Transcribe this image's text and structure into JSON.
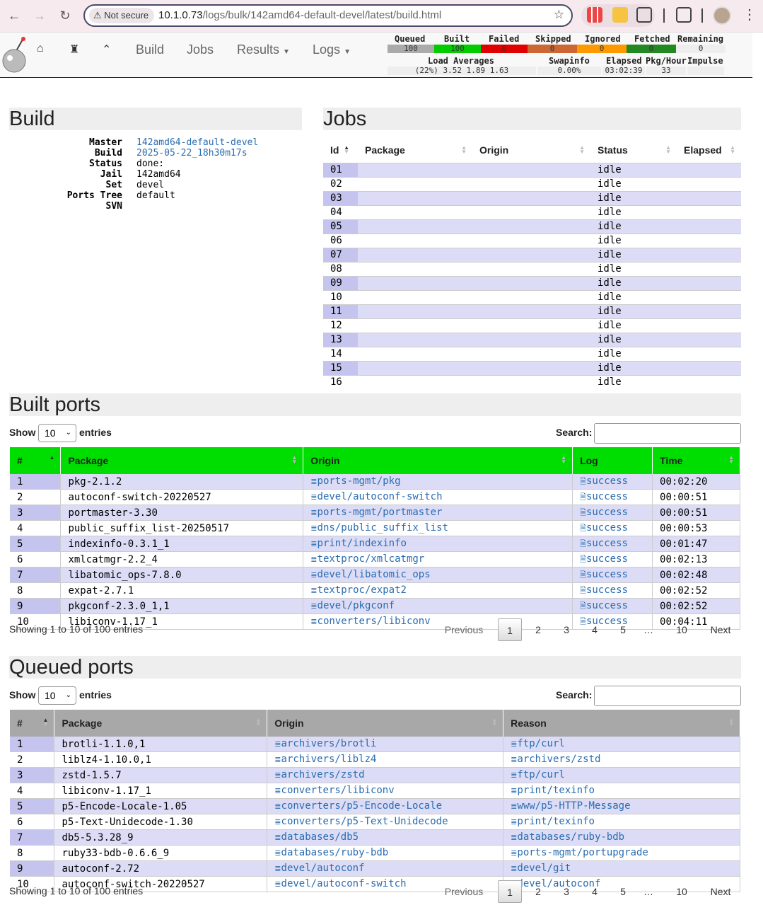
{
  "browser": {
    "security_label": "Not secure",
    "url_host": "10.1.0.73",
    "url_path": "/logs/bulk/142amd64-default-devel/latest/build.html"
  },
  "nav": {
    "links": [
      "Build",
      "Jobs",
      "Results",
      "Logs"
    ]
  },
  "stats": {
    "headers": [
      "Queued",
      "Built",
      "Failed",
      "Skipped",
      "Ignored",
      "Fetched",
      "Remaining"
    ],
    "values": [
      "100",
      "100",
      "0",
      "0",
      "0",
      "0",
      "0"
    ],
    "colors": [
      "#aaaaaa",
      "#00cc00",
      "#e00000",
      "#cc6633",
      "#ff9900",
      "#228822",
      "#eeeeee"
    ],
    "load_label": "Load Averages",
    "load_value": "(22%) 3.52 1.89 1.63",
    "swap_label": "Swapinfo",
    "swap_value": "0.00%",
    "elapsed_label": "Elapsed",
    "elapsed_value": "03:02:39",
    "pkghour_label": "Pkg/Hour",
    "pkghour_value": "33",
    "impulse_label": "Impulse",
    "impulse_value": ""
  },
  "build": {
    "title": "Build",
    "fields": [
      {
        "k": "Master",
        "v": "142amd64-default-devel",
        "link": true
      },
      {
        "k": "Build",
        "v": "2025-05-22_18h30m17s",
        "link": true
      },
      {
        "k": "Status",
        "v": "done:",
        "link": false
      },
      {
        "k": "Jail",
        "v": "142amd64",
        "link": false
      },
      {
        "k": "Set",
        "v": "devel",
        "link": false
      },
      {
        "k": "Ports Tree",
        "v": "default",
        "link": false
      },
      {
        "k": "SVN",
        "v": "",
        "link": false
      }
    ]
  },
  "jobs": {
    "title": "Jobs",
    "headers": [
      "Id",
      "Package",
      "Origin",
      "Status",
      "Elapsed"
    ],
    "rows": [
      [
        "01",
        "idle"
      ],
      [
        "02",
        "idle"
      ],
      [
        "03",
        "idle"
      ],
      [
        "04",
        "idle"
      ],
      [
        "05",
        "idle"
      ],
      [
        "06",
        "idle"
      ],
      [
        "07",
        "idle"
      ],
      [
        "08",
        "idle"
      ],
      [
        "09",
        "idle"
      ],
      [
        "10",
        "idle"
      ],
      [
        "11",
        "idle"
      ],
      [
        "12",
        "idle"
      ],
      [
        "13",
        "idle"
      ],
      [
        "14",
        "idle"
      ],
      [
        "15",
        "idle"
      ],
      [
        "16",
        "idle"
      ]
    ]
  },
  "built": {
    "title": "Built ports",
    "show": "Show",
    "entries": "entries",
    "page_size": "10",
    "search": "Search:",
    "headers": [
      "#",
      "Package",
      "Origin",
      "Log",
      "Time"
    ],
    "rows": [
      [
        "1",
        "pkg-2.1.2",
        "ports-mgmt/pkg",
        "success",
        "00:02:20"
      ],
      [
        "2",
        "autoconf-switch-20220527",
        "devel/autoconf-switch",
        "success",
        "00:00:51"
      ],
      [
        "3",
        "portmaster-3.30",
        "ports-mgmt/portmaster",
        "success",
        "00:00:51"
      ],
      [
        "4",
        "public_suffix_list-20250517",
        "dns/public_suffix_list",
        "success",
        "00:00:53"
      ],
      [
        "5",
        "indexinfo-0.3.1_1",
        "print/indexinfo",
        "success",
        "00:01:47"
      ],
      [
        "6",
        "xmlcatmgr-2.2_4",
        "textproc/xmlcatmgr",
        "success",
        "00:02:13"
      ],
      [
        "7",
        "libatomic_ops-7.8.0",
        "devel/libatomic_ops",
        "success",
        "00:02:48"
      ],
      [
        "8",
        "expat-2.7.1",
        "textproc/expat2",
        "success",
        "00:02:52"
      ],
      [
        "9",
        "pkgconf-2.3.0_1,1",
        "devel/pkgconf",
        "success",
        "00:02:52"
      ],
      [
        "10",
        "libiconv-1.17_1",
        "converters/libiconv",
        "success",
        "00:04:11"
      ]
    ],
    "info": "Showing 1 to 10 of 100 entries",
    "pager": [
      "Previous",
      "1",
      "2",
      "3",
      "4",
      "5",
      "…",
      "10",
      "Next"
    ]
  },
  "queued": {
    "title": "Queued ports",
    "show": "Show",
    "entries": "entries",
    "page_size": "10",
    "search": "Search:",
    "headers": [
      "#",
      "Package",
      "Origin",
      "Reason"
    ],
    "rows": [
      [
        "1",
        "brotli-1.1.0,1",
        "archivers/brotli",
        "ftp/curl"
      ],
      [
        "2",
        "liblz4-1.10.0,1",
        "archivers/liblz4",
        "archivers/zstd"
      ],
      [
        "3",
        "zstd-1.5.7",
        "archivers/zstd",
        "ftp/curl"
      ],
      [
        "4",
        "libiconv-1.17_1",
        "converters/libiconv",
        "print/texinfo"
      ],
      [
        "5",
        "p5-Encode-Locale-1.05",
        "converters/p5-Encode-Locale",
        "www/p5-HTTP-Message"
      ],
      [
        "6",
        "p5-Text-Unidecode-1.30",
        "converters/p5-Text-Unidecode",
        "print/texinfo"
      ],
      [
        "7",
        "db5-5.3.28_9",
        "databases/db5",
        "databases/ruby-bdb"
      ],
      [
        "8",
        "ruby33-bdb-0.6.6_9",
        "databases/ruby-bdb",
        "ports-mgmt/portupgrade"
      ],
      [
        "9",
        "autoconf-2.72",
        "devel/autoconf",
        "devel/git"
      ],
      [
        "10",
        "autoconf-switch-20220527",
        "devel/autoconf-switch",
        "devel/autoconf"
      ]
    ],
    "info": "Showing 1 to 10 of 100 entries",
    "pager": [
      "Previous",
      "1",
      "2",
      "3",
      "4",
      "5",
      "…",
      "10",
      "Next"
    ]
  }
}
